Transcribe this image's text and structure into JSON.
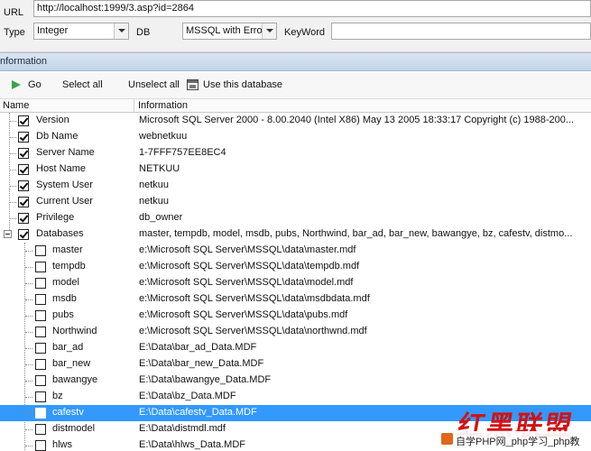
{
  "form": {
    "url_label": "URL",
    "url_value": "http://localhost:1999/3.asp?id=2864",
    "type_label": "Type",
    "type_value": "Integer",
    "db_label": "DB",
    "db_value": "MSSQL with Error",
    "keyword_label": "KeyWord",
    "keyword_value": ""
  },
  "info_header": "nformation",
  "toolbar": {
    "go_label": "Go",
    "select_all_label": "Select all",
    "unselect_all_label": "Unselect all",
    "use_db_label": "Use this database"
  },
  "grid": {
    "col_name": "Name",
    "col_info": "Information",
    "info_rows": [
      {
        "name": "Version",
        "info": "Microsoft SQL Server  2000 - 8.00.2040 (Intel X86) May 13 2005 18:33:17 Copyright (c) 1988-200...",
        "checked": true
      },
      {
        "name": "Db Name",
        "info": "webnetkuu",
        "checked": true
      },
      {
        "name": "Server Name",
        "info": "1-7FFF757EE8EC4",
        "checked": true
      },
      {
        "name": "Host Name",
        "info": "NETKUU",
        "checked": true
      },
      {
        "name": "System User",
        "info": "netkuu",
        "checked": true
      },
      {
        "name": "Current User",
        "info": "netkuu",
        "checked": true
      },
      {
        "name": "Privilege",
        "info": "db_owner",
        "checked": true
      }
    ],
    "databases": {
      "name": "Databases",
      "info": "master, tempdb, model, msdb, pubs, Northwind, bar_ad, bar_new, bawangye, bz, cafestv, distmo...",
      "checked": true,
      "children": [
        {
          "name": "master",
          "info": "e:\\Microsoft SQL Server\\MSSQL\\data\\master.mdf"
        },
        {
          "name": "tempdb",
          "info": "e:\\Microsoft SQL Server\\MSSQL\\data\\tempdb.mdf"
        },
        {
          "name": "model",
          "info": "e:\\Microsoft SQL Server\\MSSQL\\data\\model.mdf"
        },
        {
          "name": "msdb",
          "info": "e:\\Microsoft SQL Server\\MSSQL\\data\\msdbdata.mdf"
        },
        {
          "name": "pubs",
          "info": "e:\\Microsoft SQL Server\\MSSQL\\data\\pubs.mdf"
        },
        {
          "name": "Northwind",
          "info": "e:\\Microsoft SQL Server\\MSSQL\\data\\northwnd.mdf"
        },
        {
          "name": "bar_ad",
          "info": "E:\\Data\\bar_ad_Data.MDF"
        },
        {
          "name": "bar_new",
          "info": "E:\\Data\\bar_new_Data.MDF"
        },
        {
          "name": "bawangye",
          "info": "E:\\Data\\bawangye_Data.MDF"
        },
        {
          "name": "bz",
          "info": "E:\\Data\\bz_Data.MDF"
        },
        {
          "name": "cafestv",
          "info": "E:\\Data\\cafestv_Data.MDF"
        },
        {
          "name": "distmodel",
          "info": "E:\\Data\\distmdl.mdf"
        },
        {
          "name": "hlws",
          "info": "E:\\Data\\hlws_Data.MDF"
        }
      ],
      "selected": "cafestv"
    }
  },
  "watermark": {
    "text": "红黑联盟",
    "strip_text": "自学PHP网_php学习_php教"
  },
  "colors": {
    "selection": "#3399ff",
    "watermark_red": "#d21212",
    "info_bar": "#c2d3e9"
  }
}
